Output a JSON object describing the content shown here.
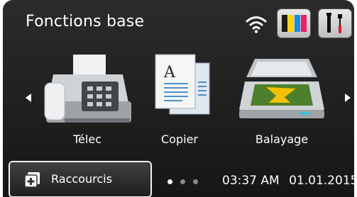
{
  "header": {
    "title": "Fonctions base",
    "icons": {
      "wifi": "wifi-icon",
      "ink": "ink-level-icon",
      "tools": "tools-icon"
    },
    "ink_colors": [
      "#1a1a1a",
      "#ffd400",
      "#1e88e5",
      "#e91e63"
    ]
  },
  "functions": [
    {
      "label": "Télec",
      "icon": "fax-icon"
    },
    {
      "label": "Copier",
      "icon": "copy-icon"
    },
    {
      "label": "Balayage",
      "icon": "scan-icon"
    }
  ],
  "navigation": {
    "left": "arrow-left-icon",
    "right": "arrow-right-icon"
  },
  "bottom": {
    "shortcut_label": "Raccourcis",
    "page_dots": 3,
    "active_dot": 0,
    "time": "03:37 AM",
    "date": "01.01.2015"
  }
}
